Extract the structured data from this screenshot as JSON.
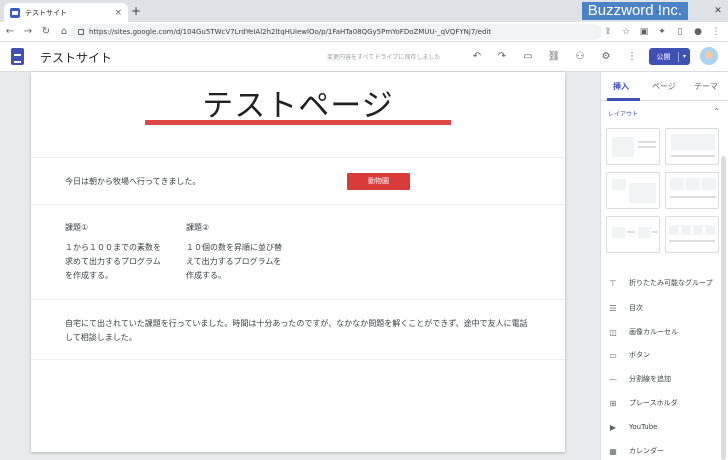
{
  "browser": {
    "tab_title": "テストサイト",
    "tab_close": "×",
    "new_tab": "+",
    "brand": "Buzzword Inc.",
    "url": "https://sites.google.com/d/104Gu5TWcV7LrdYeIAl2h2ltqHUiewlOo/p/1FaHTa08QGy5PmYoFDoZMUU-_qVQFYNj7/edit",
    "back": "←",
    "forward": "→",
    "reload": "↻",
    "home": "⌂"
  },
  "sites_header": {
    "site_name": "テストサイト",
    "save_status": "変更内容をすべてドライブに保存しました",
    "publish_label": "公開",
    "publish_caret": "▾"
  },
  "page": {
    "title": "テストページ",
    "intro": "今日は朝から牧場へ行ってきました。",
    "button_label": "動物園",
    "col1_heading": "課題①",
    "col1_body": "１から１００までの素数を求めて出力するプログラムを作成する。",
    "col2_heading": "課題②",
    "col2_body": "１０個の数を昇順に並び替えて出力するプログラムを作成する。",
    "paragraph": "自宅にて出されていた課題を行っていました。時間は十分あったのですが、なかなか問題を解くことができず、途中で友人に電話して相談しました。"
  },
  "panel": {
    "tabs": [
      "挿入",
      "ページ",
      "テーマ"
    ],
    "section_title": "レイアウト",
    "items": [
      {
        "label": "折りたたみ可能なグループ",
        "icon": "collapsible-icon"
      },
      {
        "label": "目次",
        "icon": "toc-icon"
      },
      {
        "label": "画像カルーセル",
        "icon": "carousel-icon"
      },
      {
        "label": "ボタン",
        "icon": "button-icon"
      },
      {
        "label": "分割線を追加",
        "icon": "divider-icon"
      },
      {
        "label": "プレースホルダ",
        "icon": "placeholder-icon"
      },
      {
        "label": "YouTube",
        "icon": "youtube-icon"
      },
      {
        "label": "カレンダー",
        "icon": "calendar-icon"
      }
    ]
  },
  "colors": {
    "accent": "#3f51b5",
    "title_bar": "#e04848",
    "cta": "#d93b3b"
  }
}
